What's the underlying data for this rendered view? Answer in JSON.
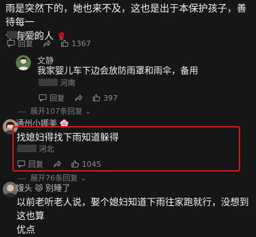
{
  "comment1": {
    "text_line1": "雨是突然下的，她也来不及，这也是出于本保护孩子，善待每一",
    "text_line2": "个有爱的人",
    "location": "黑龙江",
    "reply_label": "回复",
    "share_label": "",
    "likes": "1367"
  },
  "reply1": {
    "username": "文静",
    "text": "我家婴儿车下边会放防雨罩和雨伞，备用",
    "location": "河南",
    "reply_label": "回复",
    "likes": "397",
    "expand_label": "展开107条回复"
  },
  "comment2": {
    "username": "通州小娜美",
    "text": "找媳妇得找下雨知道躲得",
    "location": "河北",
    "reply_label": "回复",
    "likes": "1045",
    "expand_label": "展开76条回复"
  },
  "comment3": {
    "username": "馒头",
    "username_suffix": "别睡了",
    "text_line1": "以前老听老人说，娶个媳妇知道下雨往家跑就行，没想到这也算",
    "text_line2": "优点"
  },
  "colors": {
    "background": "#161616",
    "highlight": "#c62020"
  }
}
